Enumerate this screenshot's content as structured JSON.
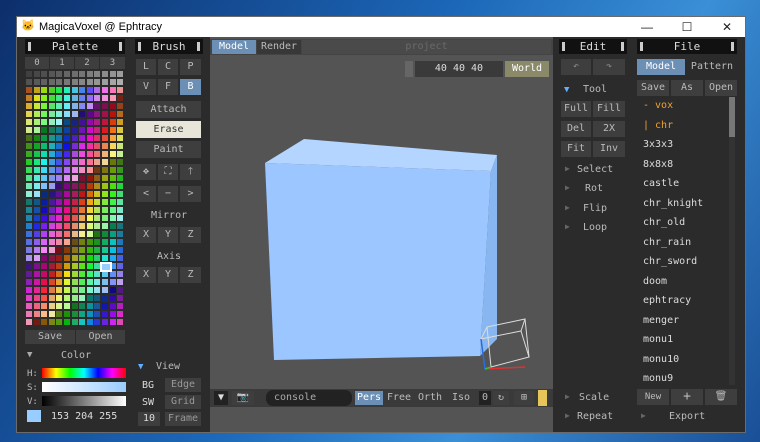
{
  "window": {
    "title": "MagicaVoxel @ Ephtracy",
    "minimize": "—",
    "maximize": "☐",
    "close": "✕"
  },
  "palette": {
    "title": "Palette",
    "tabs": [
      "0",
      "1",
      "2",
      "3"
    ],
    "save": "Save",
    "open": "Open",
    "color_label": "Color",
    "h": "H:",
    "s": "S:",
    "v": "V:",
    "rgb": "153 204 255",
    "selected_color": "#99ccff"
  },
  "brush": {
    "title": "Brush",
    "modes": [
      "L",
      "C",
      "P",
      "V",
      "F",
      "B"
    ],
    "attach": "Attach",
    "erase": "Erase",
    "paint": "Paint",
    "mirror": "Mirror",
    "axis": "Axis",
    "xyz": [
      "X",
      "Y",
      "Z"
    ],
    "view": "View",
    "bg": "BG",
    "edge": "Edge",
    "sw": "SW",
    "grid": "Grid",
    "num": "10",
    "frame": "Frame"
  },
  "viewport": {
    "tab_model": "Model",
    "tab_render": "Render",
    "project": "project",
    "dims": "40 40 40",
    "world": "World",
    "console": "console",
    "pers": "Pers",
    "free": "Free",
    "orth": "Orth",
    "iso": "Iso",
    "zero": "0",
    "cube_color": "#9cc6ff"
  },
  "edit": {
    "title": "Edit",
    "tool": "Tool",
    "full": "Full",
    "fill": "Fill",
    "del": "Del",
    "x2": "2X",
    "fit": "Fit",
    "inv": "Inv",
    "select": "Select",
    "rot": "Rot",
    "flip": "Flip",
    "loop": "Loop",
    "scale": "Scale",
    "repeat": "Repeat"
  },
  "file": {
    "title": "File",
    "tab_model": "Model",
    "tab_pattern": "Pattern",
    "save": "Save",
    "as": "As",
    "open": "Open",
    "items": [
      "- vox",
      " | chr",
      "3x3x3",
      "8x8x8",
      "castle",
      "chr_knight",
      "chr_old",
      "chr_rain",
      "chr_sword",
      "doom",
      "ephtracy",
      "menger",
      "monu1",
      "monu10",
      "monu9"
    ],
    "new": "New",
    "add": "+",
    "export": "Export"
  }
}
